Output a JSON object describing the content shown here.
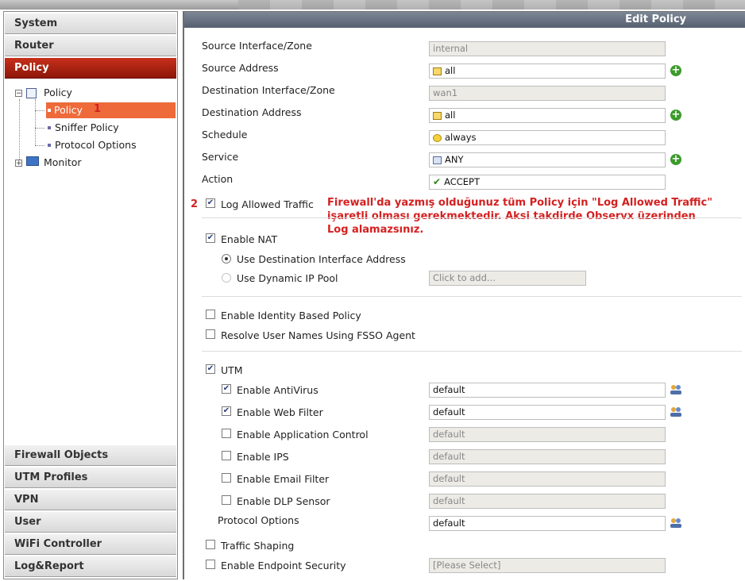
{
  "nav": {
    "sections_top": [
      "System",
      "Router",
      "Policy"
    ],
    "tree": {
      "policy_group": "Policy",
      "policy": "Policy",
      "sniffer": "Sniffer Policy",
      "protocol": "Protocol Options",
      "monitor": "Monitor"
    },
    "sections_bottom": [
      "Firewall Objects",
      "UTM Profiles",
      "VPN",
      "User",
      "WiFi Controller",
      "Log&Report"
    ],
    "annotation_1": "1"
  },
  "main": {
    "title": "Edit Policy",
    "fields": {
      "src_if_label": "Source Interface/Zone",
      "src_if_value": "internal",
      "src_addr_label": "Source Address",
      "src_addr_value": "all",
      "dst_if_label": "Destination Interface/Zone",
      "dst_if_value": "wan1",
      "dst_addr_label": "Destination Address",
      "dst_addr_value": "all",
      "schedule_label": "Schedule",
      "schedule_value": "always",
      "service_label": "Service",
      "service_value": "ANY",
      "action_label": "Action",
      "action_value": "ACCEPT"
    },
    "log": {
      "annotation_2": "2",
      "label": "Log Allowed Traffic",
      "checked": true
    },
    "note": "Firewall'da yazmış olduğunuz tüm Policy için \"Log Allowed Traffic\" işaretli olması gerekmektedir. Aksi takdirde Observx üzerinden Log alamazsınız.",
    "nat": {
      "label": "Enable NAT",
      "use_dest_if": "Use Destination Interface Address",
      "use_dynamic_pool": "Use Dynamic IP Pool",
      "pool_placeholder": "Click to add..."
    },
    "identity": {
      "enable_identity": "Enable Identity Based Policy",
      "resolve_fsso": "Resolve User Names Using FSSO Agent"
    },
    "utm": {
      "label": "UTM",
      "antivirus_label": "Enable AntiVirus",
      "antivirus_value": "default",
      "webfilter_label": "Enable Web Filter",
      "webfilter_value": "default",
      "appctrl_label": "Enable Application Control",
      "appctrl_value": "default",
      "ips_label": "Enable IPS",
      "ips_value": "default",
      "email_label": "Enable Email Filter",
      "email_value": "default",
      "dlp_label": "Enable DLP Sensor",
      "dlp_value": "default",
      "protocol_label": "Protocol Options",
      "protocol_value": "default"
    },
    "traffic_shaping": "Traffic Shaping",
    "endpoint": {
      "label": "Enable Endpoint Security",
      "value": "[Please Select]"
    }
  },
  "colors": {
    "accent_red": "#b3200f",
    "highlight_orange": "#ee6a3a",
    "annotation_red": "#d42020"
  }
}
